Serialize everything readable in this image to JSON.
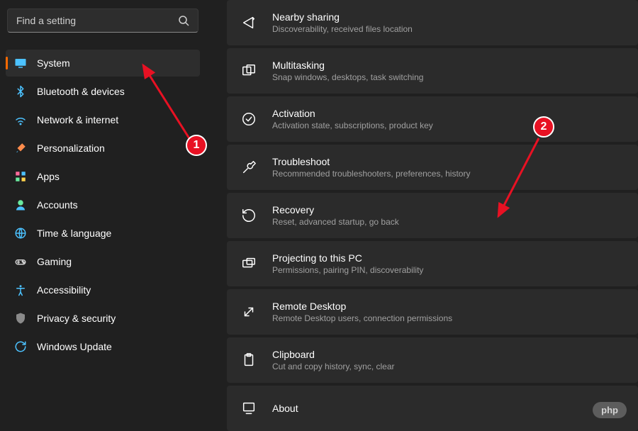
{
  "search": {
    "placeholder": "Find a setting"
  },
  "sidebar": {
    "items": [
      {
        "label": "System",
        "icon": "monitor",
        "active": true
      },
      {
        "label": "Bluetooth & devices",
        "icon": "bluetooth",
        "active": false
      },
      {
        "label": "Network & internet",
        "icon": "wifi",
        "active": false
      },
      {
        "label": "Personalization",
        "icon": "brush",
        "active": false
      },
      {
        "label": "Apps",
        "icon": "apps",
        "active": false
      },
      {
        "label": "Accounts",
        "icon": "person",
        "active": false
      },
      {
        "label": "Time & language",
        "icon": "globe",
        "active": false
      },
      {
        "label": "Gaming",
        "icon": "gamepad",
        "active": false
      },
      {
        "label": "Accessibility",
        "icon": "access",
        "active": false
      },
      {
        "label": "Privacy & security",
        "icon": "shield",
        "active": false
      },
      {
        "label": "Windows Update",
        "icon": "update",
        "active": false
      }
    ]
  },
  "settings_cards": [
    {
      "title": "Nearby sharing",
      "desc": "Discoverability, received files location",
      "icon": "share"
    },
    {
      "title": "Multitasking",
      "desc": "Snap windows, desktops, task switching",
      "icon": "multitask"
    },
    {
      "title": "Activation",
      "desc": "Activation state, subscriptions, product key",
      "icon": "check"
    },
    {
      "title": "Troubleshoot",
      "desc": "Recommended troubleshooters, preferences, history",
      "icon": "wrench"
    },
    {
      "title": "Recovery",
      "desc": "Reset, advanced startup, go back",
      "icon": "recovery"
    },
    {
      "title": "Projecting to this PC",
      "desc": "Permissions, pairing PIN, discoverability",
      "icon": "project"
    },
    {
      "title": "Remote Desktop",
      "desc": "Remote Desktop users, connection permissions",
      "icon": "remote"
    },
    {
      "title": "Clipboard",
      "desc": "Cut and copy history, sync, clear",
      "icon": "clipboard"
    },
    {
      "title": "About",
      "desc": "",
      "icon": "about"
    }
  ],
  "annotations": {
    "badge1": "1",
    "badge2": "2",
    "arrow_color": "#e81123"
  },
  "watermark": "php"
}
